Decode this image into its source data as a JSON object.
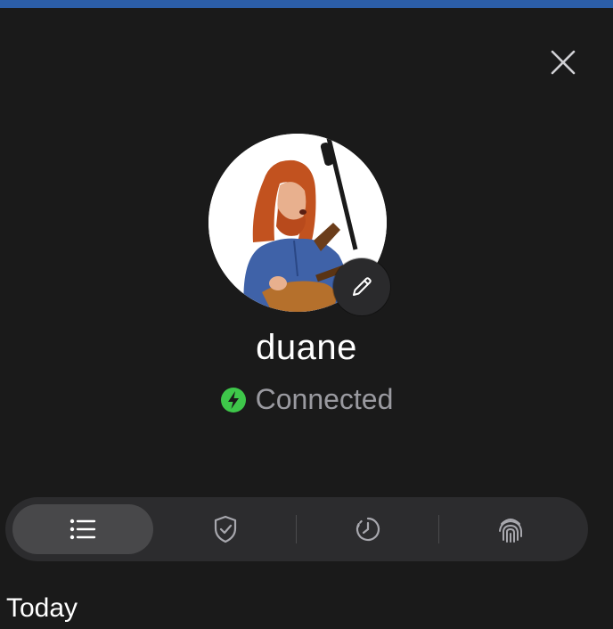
{
  "profile": {
    "username": "duane",
    "status_text": "Connected",
    "status_color": "#3ec74a"
  },
  "icons": {
    "close": "close-icon",
    "edit": "pencil-icon",
    "status": "bolt-icon",
    "tabs": [
      "list-icon",
      "shield-check-icon",
      "clock-icon",
      "fingerprint-icon"
    ]
  },
  "tabs": {
    "active_index": 0
  },
  "list": {
    "section_title": "Today"
  },
  "colors": {
    "background": "#1a1a1a",
    "tabbar": "#2c2c2e",
    "active_tab": "#48484a",
    "top_accent": "#2c5ea8",
    "muted_text": "#9a9aa0"
  }
}
